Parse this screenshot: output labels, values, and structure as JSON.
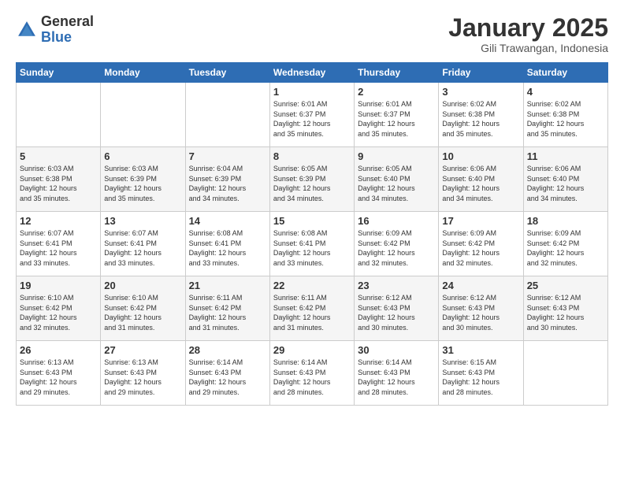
{
  "logo": {
    "general": "General",
    "blue": "Blue"
  },
  "header": {
    "title": "January 2025",
    "subtitle": "Gili Trawangan, Indonesia"
  },
  "weekdays": [
    "Sunday",
    "Monday",
    "Tuesday",
    "Wednesday",
    "Thursday",
    "Friday",
    "Saturday"
  ],
  "weeks": [
    [
      {
        "day": "",
        "info": ""
      },
      {
        "day": "",
        "info": ""
      },
      {
        "day": "",
        "info": ""
      },
      {
        "day": "1",
        "info": "Sunrise: 6:01 AM\nSunset: 6:37 PM\nDaylight: 12 hours\nand 35 minutes."
      },
      {
        "day": "2",
        "info": "Sunrise: 6:01 AM\nSunset: 6:37 PM\nDaylight: 12 hours\nand 35 minutes."
      },
      {
        "day": "3",
        "info": "Sunrise: 6:02 AM\nSunset: 6:38 PM\nDaylight: 12 hours\nand 35 minutes."
      },
      {
        "day": "4",
        "info": "Sunrise: 6:02 AM\nSunset: 6:38 PM\nDaylight: 12 hours\nand 35 minutes."
      }
    ],
    [
      {
        "day": "5",
        "info": "Sunrise: 6:03 AM\nSunset: 6:38 PM\nDaylight: 12 hours\nand 35 minutes."
      },
      {
        "day": "6",
        "info": "Sunrise: 6:03 AM\nSunset: 6:39 PM\nDaylight: 12 hours\nand 35 minutes."
      },
      {
        "day": "7",
        "info": "Sunrise: 6:04 AM\nSunset: 6:39 PM\nDaylight: 12 hours\nand 34 minutes."
      },
      {
        "day": "8",
        "info": "Sunrise: 6:05 AM\nSunset: 6:39 PM\nDaylight: 12 hours\nand 34 minutes."
      },
      {
        "day": "9",
        "info": "Sunrise: 6:05 AM\nSunset: 6:40 PM\nDaylight: 12 hours\nand 34 minutes."
      },
      {
        "day": "10",
        "info": "Sunrise: 6:06 AM\nSunset: 6:40 PM\nDaylight: 12 hours\nand 34 minutes."
      },
      {
        "day": "11",
        "info": "Sunrise: 6:06 AM\nSunset: 6:40 PM\nDaylight: 12 hours\nand 34 minutes."
      }
    ],
    [
      {
        "day": "12",
        "info": "Sunrise: 6:07 AM\nSunset: 6:41 PM\nDaylight: 12 hours\nand 33 minutes."
      },
      {
        "day": "13",
        "info": "Sunrise: 6:07 AM\nSunset: 6:41 PM\nDaylight: 12 hours\nand 33 minutes."
      },
      {
        "day": "14",
        "info": "Sunrise: 6:08 AM\nSunset: 6:41 PM\nDaylight: 12 hours\nand 33 minutes."
      },
      {
        "day": "15",
        "info": "Sunrise: 6:08 AM\nSunset: 6:41 PM\nDaylight: 12 hours\nand 33 minutes."
      },
      {
        "day": "16",
        "info": "Sunrise: 6:09 AM\nSunset: 6:42 PM\nDaylight: 12 hours\nand 32 minutes."
      },
      {
        "day": "17",
        "info": "Sunrise: 6:09 AM\nSunset: 6:42 PM\nDaylight: 12 hours\nand 32 minutes."
      },
      {
        "day": "18",
        "info": "Sunrise: 6:09 AM\nSunset: 6:42 PM\nDaylight: 12 hours\nand 32 minutes."
      }
    ],
    [
      {
        "day": "19",
        "info": "Sunrise: 6:10 AM\nSunset: 6:42 PM\nDaylight: 12 hours\nand 32 minutes."
      },
      {
        "day": "20",
        "info": "Sunrise: 6:10 AM\nSunset: 6:42 PM\nDaylight: 12 hours\nand 31 minutes."
      },
      {
        "day": "21",
        "info": "Sunrise: 6:11 AM\nSunset: 6:42 PM\nDaylight: 12 hours\nand 31 minutes."
      },
      {
        "day": "22",
        "info": "Sunrise: 6:11 AM\nSunset: 6:42 PM\nDaylight: 12 hours\nand 31 minutes."
      },
      {
        "day": "23",
        "info": "Sunrise: 6:12 AM\nSunset: 6:43 PM\nDaylight: 12 hours\nand 30 minutes."
      },
      {
        "day": "24",
        "info": "Sunrise: 6:12 AM\nSunset: 6:43 PM\nDaylight: 12 hours\nand 30 minutes."
      },
      {
        "day": "25",
        "info": "Sunrise: 6:12 AM\nSunset: 6:43 PM\nDaylight: 12 hours\nand 30 minutes."
      }
    ],
    [
      {
        "day": "26",
        "info": "Sunrise: 6:13 AM\nSunset: 6:43 PM\nDaylight: 12 hours\nand 29 minutes."
      },
      {
        "day": "27",
        "info": "Sunrise: 6:13 AM\nSunset: 6:43 PM\nDaylight: 12 hours\nand 29 minutes."
      },
      {
        "day": "28",
        "info": "Sunrise: 6:14 AM\nSunset: 6:43 PM\nDaylight: 12 hours\nand 29 minutes."
      },
      {
        "day": "29",
        "info": "Sunrise: 6:14 AM\nSunset: 6:43 PM\nDaylight: 12 hours\nand 28 minutes."
      },
      {
        "day": "30",
        "info": "Sunrise: 6:14 AM\nSunset: 6:43 PM\nDaylight: 12 hours\nand 28 minutes."
      },
      {
        "day": "31",
        "info": "Sunrise: 6:15 AM\nSunset: 6:43 PM\nDaylight: 12 hours\nand 28 minutes."
      },
      {
        "day": "",
        "info": ""
      }
    ]
  ]
}
